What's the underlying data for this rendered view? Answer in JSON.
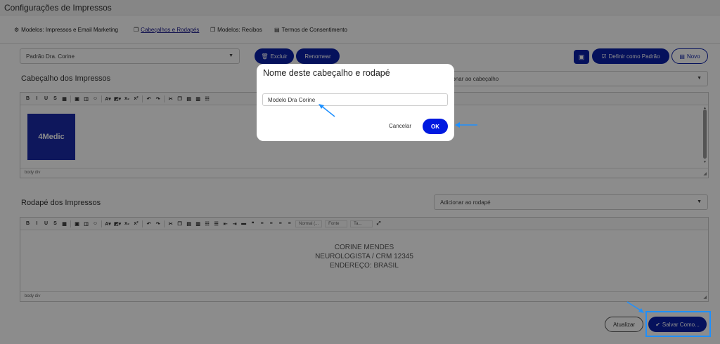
{
  "window": {
    "title": "Configurações de Impressos"
  },
  "tabs": [
    {
      "label": "Modelos: Impressos e Email Marketing",
      "icon": "gear-icon"
    },
    {
      "label": "Cabeçalhos e Rodapés",
      "icon": "copy-icon"
    },
    {
      "label": "Modelos: Recibos",
      "icon": "copy-icon"
    },
    {
      "label": "Termos de Consentimento",
      "icon": "document-icon"
    }
  ],
  "template_select": {
    "value": "Padrão Dra. Corine"
  },
  "actions": {
    "delete_label": "Excluir",
    "rename_label": "Renomear",
    "set_default_label": "Definir como Padrão",
    "new_label": "Novo"
  },
  "header_section": {
    "title": "Cabeçalho dos Impressos",
    "add_select": "Adicionar ao cabeçalho",
    "add_select_visible": "nar ao cabeçalho",
    "status_path": "body  div",
    "logo_text": "4Medic"
  },
  "footer_section": {
    "title": "Rodapé dos Impressos",
    "add_select": "Adicionar ao rodapé",
    "status_path": "body  div",
    "lines": [
      "CORINE MENDES",
      "NEUROLOGISTA / CRM 12345",
      "ENDEREÇO: BRASIL"
    ]
  },
  "toolbar": {
    "buttons": [
      "B",
      "I",
      "U",
      "S"
    ],
    "format_drop": "Normal (...",
    "font_drop": "Fonte",
    "size_drop": "Ta..."
  },
  "bottom": {
    "update_label": "Atualizar",
    "save_as_label": "Salvar Como..."
  },
  "modal": {
    "title": "Nome deste cabeçalho e rodapé",
    "input_value": "Modelo Dra Corine",
    "cancel_label": "Cancelar",
    "ok_label": "OK"
  },
  "colors": {
    "accent": "#0a1fa8",
    "ok": "#0019e0",
    "annotation": "#1e90ff"
  }
}
